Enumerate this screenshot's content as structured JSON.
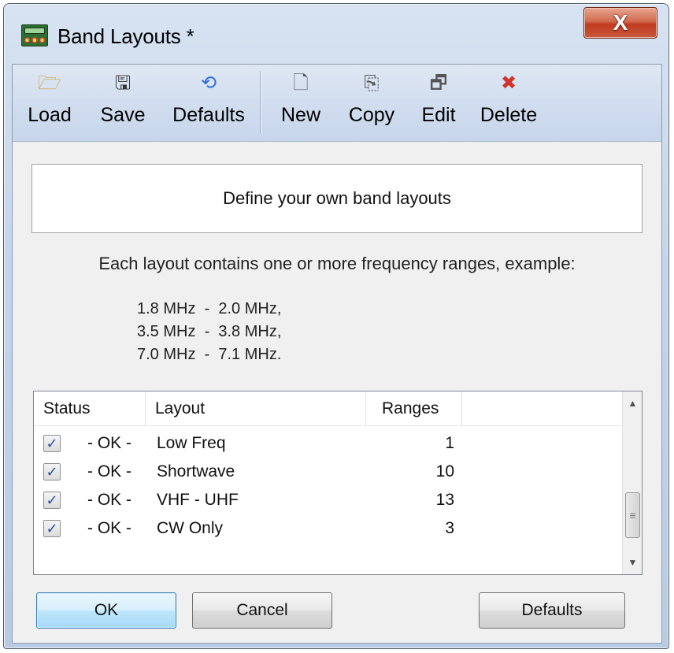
{
  "window": {
    "title": "Band Layouts *",
    "icon": "app-radio-icon",
    "close_glyph": "X"
  },
  "toolbar": {
    "items": [
      {
        "label": "Load",
        "icon": "open-folder-icon",
        "glyph": "🗁"
      },
      {
        "label": "Save",
        "icon": "floppy-disk-icon",
        "glyph": "🖫"
      },
      {
        "label": "Defaults",
        "icon": "refresh-arrows-icon",
        "glyph": "⟲"
      },
      {
        "label": "New",
        "icon": "new-document-icon",
        "glyph": "🗋"
      },
      {
        "label": "Copy",
        "icon": "copy-icon",
        "glyph": "⎘"
      },
      {
        "label": "Edit",
        "icon": "edit-properties-icon",
        "glyph": "🗗"
      },
      {
        "label": "Delete",
        "icon": "delete-x-icon",
        "glyph": "✖"
      }
    ],
    "colors": {
      "delete": "#d2322d",
      "defaults": "#2d6fd6",
      "folder": "#c9a13a"
    }
  },
  "info_box": {
    "text": "Define your own band layouts"
  },
  "description": "Each layout contains one or more frequency ranges, example:",
  "example_lines": [
    "1.8 MHz  -  2.0 MHz,",
    "3.5 MHz  -  3.8 MHz,",
    "7.0 MHz  -  7.1 MHz."
  ],
  "list": {
    "columns": [
      "Status",
      "Layout",
      "Ranges"
    ],
    "rows": [
      {
        "checked": true,
        "status": "- OK -",
        "layout": "Low Freq",
        "ranges": "1"
      },
      {
        "checked": true,
        "status": "- OK -",
        "layout": "Shortwave",
        "ranges": "10"
      },
      {
        "checked": true,
        "status": "- OK -",
        "layout": "VHF - UHF",
        "ranges": "13"
      },
      {
        "checked": true,
        "status": "- OK -",
        "layout": "CW Only",
        "ranges": "3"
      }
    ]
  },
  "buttons": {
    "ok": "OK",
    "cancel": "Cancel",
    "defaults": "Defaults"
  }
}
